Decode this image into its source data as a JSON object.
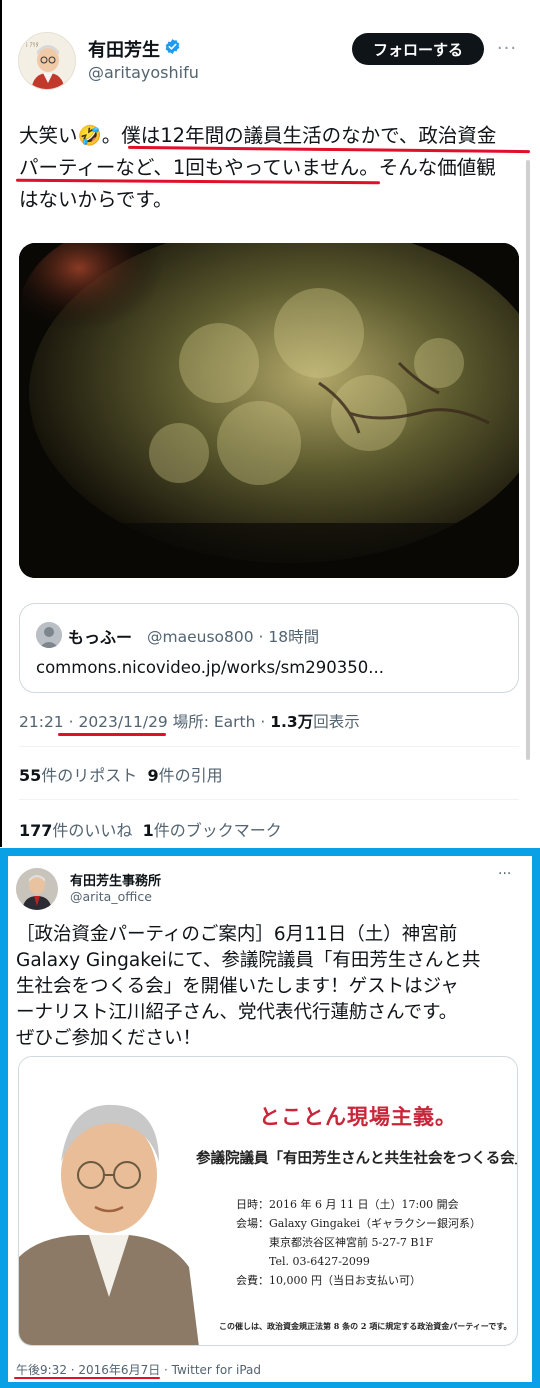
{
  "tweet1": {
    "display_name": "有田芳生",
    "handle": "@aritayoshifu",
    "follow_label": "フォローする",
    "more_label": "···",
    "text_lines": [
      "大笑い🤣。僕は12年間の議員生活のなかで、政治資金",
      "パーティーなど、1回もやっていません。そんな価値観",
      "はないからです。"
    ],
    "quote": {
      "name": "もっふー",
      "meta": "@maeuso800 · 18時間",
      "link": "commons.nicovideo.jp/works/sm290350..."
    },
    "meta": {
      "time": "21:21 · ",
      "date": "2023/11/29",
      "location": " 場所: Earth · ",
      "views_num": "1.3万",
      "views_label": "回表示"
    },
    "reposts_num": "55",
    "reposts_label": "件のリポスト",
    "quotes_num": "9",
    "quotes_label": "件の引用",
    "likes_num": "177",
    "likes_label": "件のいいね",
    "bookmarks_num": "1",
    "bookmarks_label": "件のブックマーク"
  },
  "tweet2": {
    "display_name": "有田芳生事務所",
    "handle": "@arita_office",
    "more_label": "···",
    "text_lines": [
      "［政治資金パーティのご案内］6月11日（土）神宮前",
      "Galaxy Gingakeiにて、参議院議員「有田芳生さんと共",
      "生社会をつくる会」を開催いたします！ゲストはジャ",
      "ーナリスト江川紹子さん、党代表代行蓮舫さんです。",
      "ぜひご参加ください！"
    ],
    "flyer": {
      "headline": "とことん現場主義。",
      "org": "参議院議員「有田芳生さんと共生社会をつくる会」",
      "details": [
        "日時：2016 年 6 月 11 日（土）17:00 開会",
        "会場：Galaxy Gingakei（ギャラクシー銀河系）",
        "　　　東京都渋谷区神宮前 5-27-7 B1F",
        "　　　Tel. 03-6427-2099",
        "会費：10,000 円（当日お支払い可）"
      ],
      "footnote": "この催しは、政治資金規正法第 8 条の 2 項に規定する政治資金パーティーです。"
    },
    "meta_date": "午後9:32 · 2016年6月7日",
    "meta_source": " · Twitter for iPad"
  },
  "colors": {
    "accent_red": "#e0102a",
    "frame_blue": "#0aa0e6",
    "verified_blue": "#1d9bf0",
    "flyer_red": "#c8273a"
  }
}
